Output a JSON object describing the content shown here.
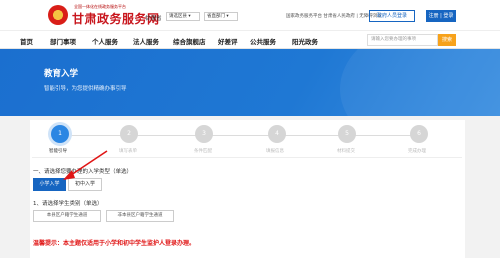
{
  "header": {
    "slogan": "全国一体化在线政务服务平台",
    "site_title": "甘肃政务服务网",
    "region_label": "甘肃省",
    "region_select": "请选区县 ▾",
    "dept_select": "省直部门 ▾",
    "top_links": "国家政务服务平台  甘肃省人民政府  |  无障碍浏览",
    "enterprise_button": "政府人员登录",
    "login_button": "注册 | 登录"
  },
  "nav": {
    "items": [
      "首页",
      "部门事项",
      "个人服务",
      "法人服务",
      "综合旗舰店",
      "好差评",
      "公共服务",
      "阳光政务"
    ],
    "search_placeholder": "请输入您要办理的事项",
    "search_button": "搜索"
  },
  "banner": {
    "title": "教育入学",
    "subtitle": "智能引导，为您提供精确办事引导"
  },
  "steps": [
    {
      "number": "1",
      "label": "智能引导"
    },
    {
      "number": "2",
      "label": "填写表单"
    },
    {
      "number": "3",
      "label": "条件匹配"
    },
    {
      "number": "4",
      "label": "填报信息"
    },
    {
      "number": "5",
      "label": "材料提交"
    },
    {
      "number": "6",
      "label": "完成办理"
    }
  ],
  "form": {
    "question1": "一、请选择您要办理的入学类型（单选）",
    "option_primary": "小学入学",
    "option_secondary": "初中入学",
    "question2": "1、请选择学生类别（单选）",
    "option2_a": "本县区户籍学生通道",
    "option2_b": "非本县区户籍学生通道",
    "warning": "温馨提示：本主题仅适用于小学和初中学生监护人登录办理。"
  },
  "colors": {
    "brand_red": "#c8161d",
    "primary_blue": "#1665c1",
    "search_orange": "#f7a21b",
    "warning_red": "#e01515"
  }
}
